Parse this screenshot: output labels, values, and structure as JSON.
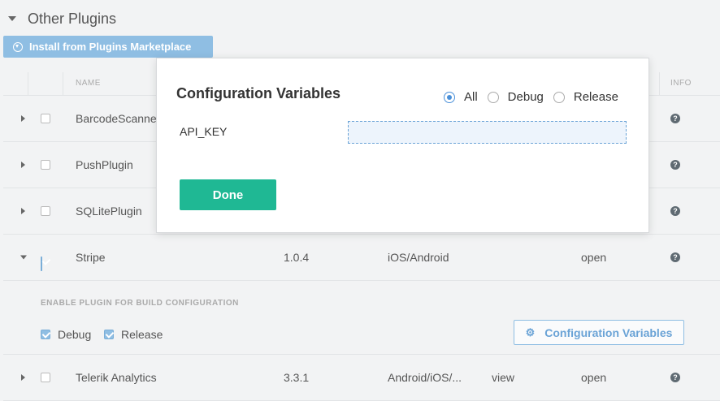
{
  "section": {
    "title": "Other Plugins"
  },
  "install_button": {
    "label": "Install from Plugins Marketplace"
  },
  "table": {
    "headers": {
      "name": "NAME",
      "info": "INFO"
    },
    "rows": [
      {
        "name": "BarcodeScanner",
        "version": "",
        "platforms": "",
        "docs": "",
        "license": "",
        "checked": false
      },
      {
        "name": "PushPlugin",
        "version": "",
        "platforms": "",
        "docs": "",
        "license": "",
        "checked": false
      },
      {
        "name": "SQLitePlugin",
        "version": "",
        "platforms": "",
        "docs": "",
        "license": "",
        "checked": false
      },
      {
        "name": "Stripe",
        "version": "1.0.4",
        "platforms": "iOS/Android",
        "docs": "",
        "license": "open",
        "checked": true,
        "expanded": true
      },
      {
        "name": "Telerik Analytics",
        "version": "3.3.1",
        "platforms": "Android/iOS/...",
        "docs": "view",
        "license": "open",
        "checked": false
      }
    ]
  },
  "expanded": {
    "label": "ENABLE PLUGIN FOR BUILD CONFIGURATION",
    "debug_label": "Debug",
    "release_label": "Release",
    "config_button_label": "Configuration Variables"
  },
  "modal": {
    "title": "Configuration Variables",
    "radio_options": [
      "All",
      "Debug",
      "Release"
    ],
    "selected": "All",
    "variable_label": "API_KEY",
    "variable_value": "",
    "done_label": "Done"
  },
  "colors": {
    "accent": "#8fbee3",
    "done": "#1fb894",
    "link": "#6aa3d6"
  }
}
